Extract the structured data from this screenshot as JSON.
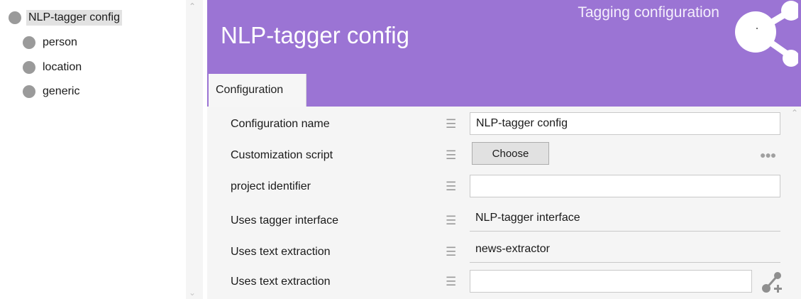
{
  "tree": {
    "items": [
      {
        "label": "NLP-tagger config",
        "selected": true
      },
      {
        "label": "person"
      },
      {
        "label": "location"
      },
      {
        "label": "generic"
      }
    ]
  },
  "header": {
    "subtitle": "Tagging configuration",
    "title": "NLP-tagger config",
    "background_color": "#9b74d4",
    "logo_icon": "share-nodes-icon"
  },
  "tabs": [
    {
      "label": "Configuration",
      "active": true
    }
  ],
  "form": {
    "rows": [
      {
        "label": "Configuration name",
        "kind": "textbox",
        "value": "NLP-tagger config"
      },
      {
        "label": "Customization script",
        "kind": "button",
        "button_label": "Choose",
        "extra_icon": "more-dots-icon"
      },
      {
        "label": "project identifier",
        "kind": "textbox",
        "value": ""
      },
      {
        "label": "Uses tagger interface",
        "kind": "readonly",
        "value": "NLP-tagger interface"
      },
      {
        "label": "Uses text extraction",
        "kind": "readonly",
        "value": "news-extractor"
      },
      {
        "label": "Uses text extraction",
        "kind": "textbox",
        "value": "",
        "extra_icon": "add-link-icon"
      }
    ],
    "row_menu_icon": "hamburger-menu-icon"
  }
}
